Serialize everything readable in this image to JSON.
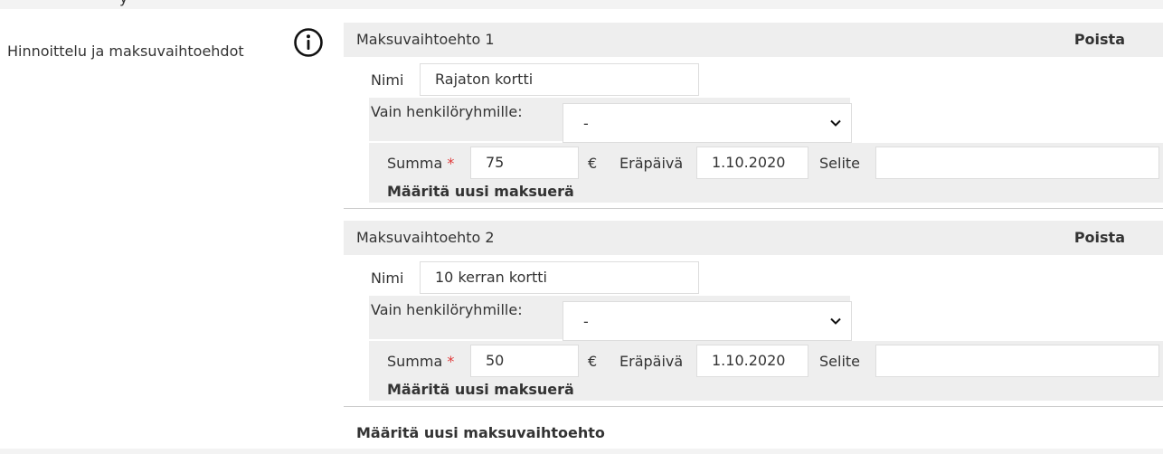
{
  "section": {
    "label": "Hinnoittelu ja maksuvaihtoehdot",
    "top_fragment": "y"
  },
  "options": [
    {
      "title": "Maksuvaihtoehto 1",
      "remove_label": "Poista",
      "name_label": "Nimi",
      "name_value": "Rajaton kortti",
      "groups_label": "Vain henkilöryhmille:",
      "groups_value": "-",
      "amount_label": "Summa",
      "required_mark": "*",
      "amount_value": "75",
      "currency": "€",
      "due_label": "Eräpäivä",
      "due_value": "1.10.2020",
      "desc_label": "Selite",
      "desc_value": "",
      "add_installment_label": "Määritä uusi maksuerä"
    },
    {
      "title": "Maksuvaihtoehto 2",
      "remove_label": "Poista",
      "name_label": "Nimi",
      "name_value": "10 kerran kortti",
      "groups_label": "Vain henkilöryhmille:",
      "groups_value": "-",
      "amount_label": "Summa",
      "required_mark": "*",
      "amount_value": "50",
      "currency": "€",
      "due_label": "Eräpäivä",
      "due_value": "1.10.2020",
      "desc_label": "Selite",
      "desc_value": "",
      "add_installment_label": "Määritä uusi maksuerä"
    }
  ],
  "add_option_label": "Määritä uusi maksuvaihtoehto",
  "icons": {
    "info": "info-circle-icon",
    "dropdown": "chevron-down-icon"
  }
}
